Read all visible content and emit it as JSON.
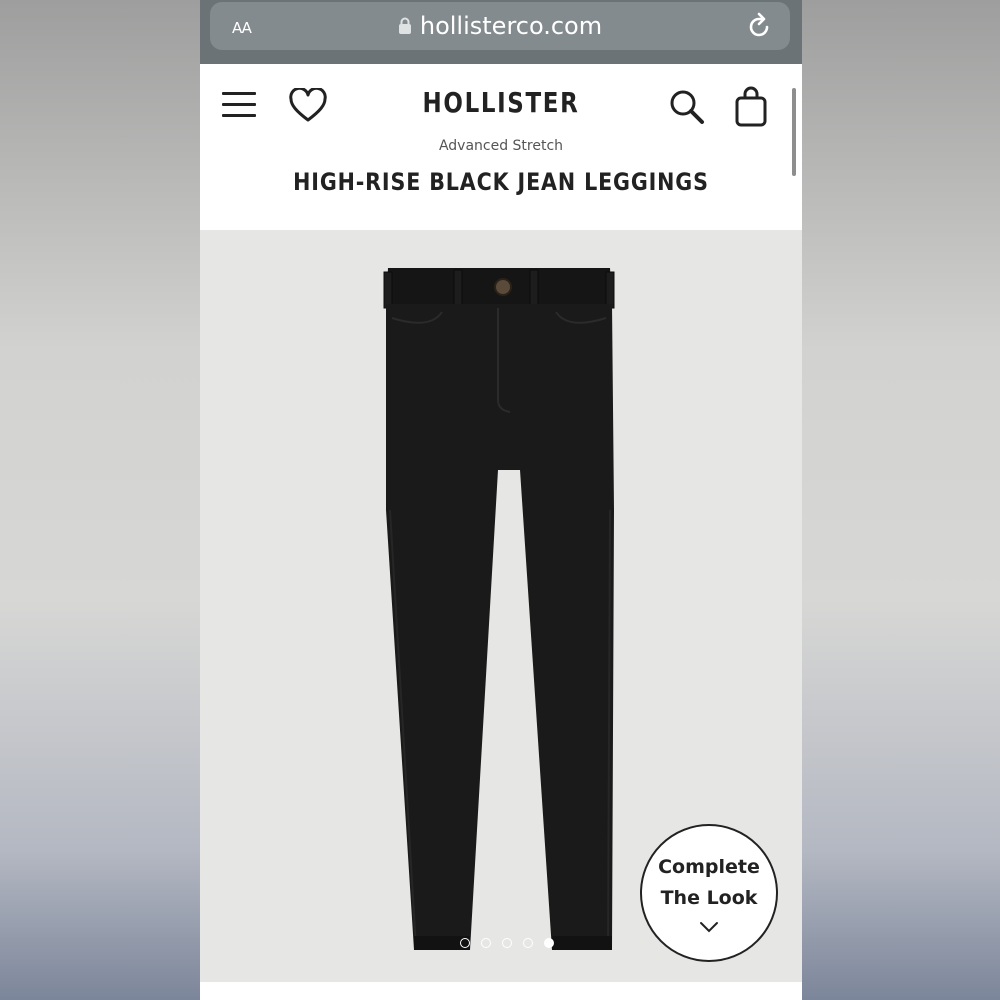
{
  "browser": {
    "text_size_label": "AA",
    "url": "hollisterco.com"
  },
  "header": {
    "brand": "HOLLISTER"
  },
  "product": {
    "subtitle": "Advanced Stretch",
    "title": "HIGH-RISE BLACK JEAN LEGGINGS"
  },
  "gallery": {
    "image_count": 5,
    "active_index": 4,
    "complete_look_line1": "Complete",
    "complete_look_line2": "The Look"
  },
  "icons": [
    "lock-icon",
    "reload-icon",
    "menu-icon",
    "heart-icon",
    "search-icon",
    "bag-icon",
    "chevron-down-icon"
  ],
  "colors": {
    "safari_bar": "#6b7377",
    "gallery_bg": "#e6e6e4",
    "product": "#1a1a1a"
  }
}
